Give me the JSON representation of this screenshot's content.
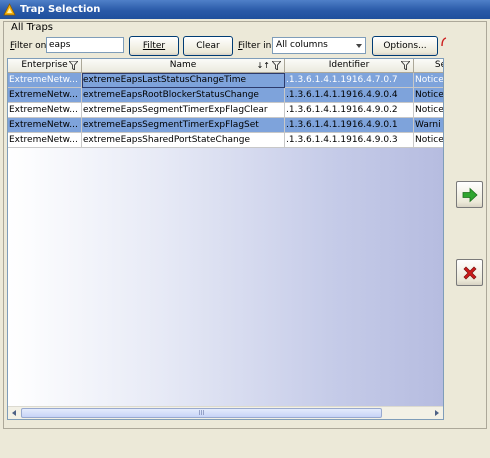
{
  "window": {
    "title": "Trap Selection"
  },
  "group": {
    "label": "All Traps"
  },
  "filter": {
    "filter_on_prefix": "F",
    "filter_on_rest": "ilter on:",
    "value": "eaps",
    "filter_button": "Filter",
    "clear_button": "Clear",
    "filter_in_prefix": "F",
    "filter_in_rest": "ilter in:",
    "filter_in_value": "All columns",
    "options_button": "Options..."
  },
  "table": {
    "columns": [
      "Enterprise",
      "Name",
      "Identifier",
      "Se"
    ],
    "rows": [
      {
        "enterprise": "ExtremeNetw...",
        "name": "extremeEapsLastStatusChangeTime",
        "identifier": ".1.3.6.1.4.1.1916.4.7.0.7",
        "severity": "Notice",
        "selected": true
      },
      {
        "enterprise": "ExtremeNetw...",
        "name": "extremeEapsRootBlockerStatusChange",
        "identifier": ".1.3.6.1.4.1.1916.4.9.0.4",
        "severity": "Notice",
        "selected": true
      },
      {
        "enterprise": "ExtremeNetw...",
        "name": "extremeEapsSegmentTimerExpFlagClear",
        "identifier": ".1.3.6.1.4.1.1916.4.9.0.2",
        "severity": "Notice",
        "selected": false
      },
      {
        "enterprise": "ExtremeNetw...",
        "name": "extremeEapsSegmentTimerExpFlagSet",
        "identifier": ".1.3.6.1.4.1.1916.4.9.0.1",
        "severity": "Warni",
        "selected": true
      },
      {
        "enterprise": "ExtremeNetw...",
        "name": "extremeEapsSharedPortStateChange",
        "identifier": ".1.3.6.1.4.1.1916.4.9.0.3",
        "severity": "Notice",
        "selected": false
      }
    ],
    "scroll_thumb_grip": "III"
  },
  "icons": {
    "title": "app-logo-icon",
    "add": "green-arrow-right-icon",
    "remove": "red-x-icon",
    "filter": "funnel-icon",
    "sort": "sort-ascending-icon"
  },
  "colors": {
    "selection": "#7ea3db",
    "title_bar": "#2a5aa8",
    "add_arrow": "#2fa52f",
    "remove_x": "#cc1c1c"
  }
}
